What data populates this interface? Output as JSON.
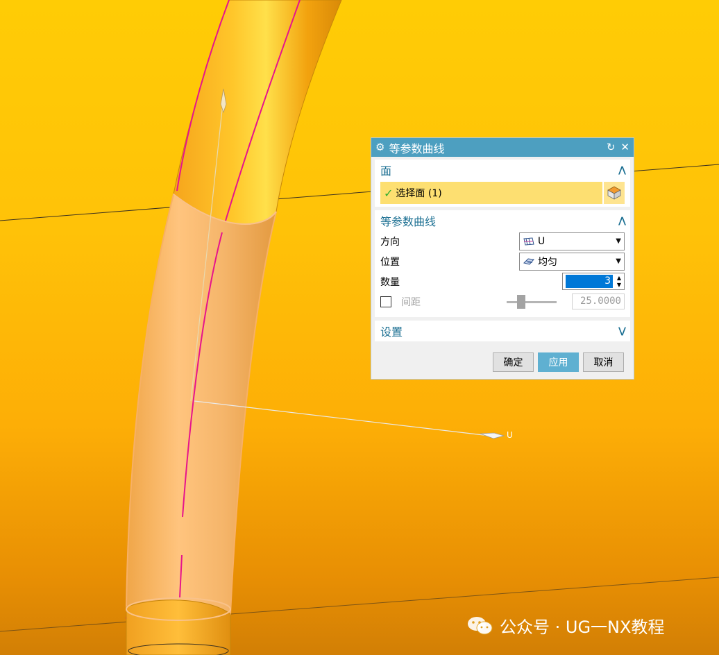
{
  "dialog": {
    "title": "等参数曲线",
    "title_icon": "gear-icon",
    "face_section": {
      "heading": "面",
      "select_label": "选择面 (1)"
    },
    "curve_section": {
      "heading": "等参数曲线",
      "direction_label": "方向",
      "direction_value": "U",
      "position_label": "位置",
      "position_value": "均匀",
      "count_label": "数量",
      "count_value": "3",
      "spacing_label": "间距",
      "spacing_value": "25.0000"
    },
    "settings_section": {
      "heading": "设置"
    },
    "buttons": {
      "ok": "确定",
      "apply": "应用",
      "cancel": "取消"
    }
  },
  "viewport": {
    "u_label": "U"
  },
  "watermark": "公众号 · UG一NX教程",
  "colors": {
    "background": "#ffc208",
    "title_bar": "#4d9fc0",
    "selection_highlight": "#fddf71",
    "iso_curve": "#e6148c",
    "apply_button": "#5fb0d1"
  }
}
